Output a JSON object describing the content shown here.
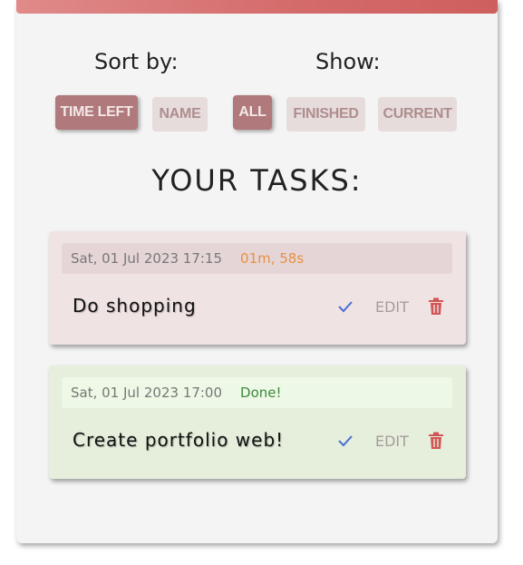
{
  "sort": {
    "label": "Sort by:",
    "options": [
      {
        "label": "TIME LEFT",
        "active": true
      },
      {
        "label": "NAME",
        "active": false
      }
    ]
  },
  "show": {
    "label": "Show:",
    "options": [
      {
        "label": "ALL",
        "active": true
      },
      {
        "label": "FINISHED",
        "active": false
      },
      {
        "label": "CURRENT",
        "active": false
      }
    ]
  },
  "tasks_title": "YOUR TASKS:",
  "tasks": [
    {
      "date": "Sat, 01 Jul 2023 17:15",
      "status": "01m, 58s",
      "name": "Do shopping",
      "edit_label": "EDIT",
      "done": false
    },
    {
      "date": "Sat, 01 Jul 2023 17:00",
      "status": "Done!",
      "name": "Create portfolio web!",
      "edit_label": "EDIT",
      "done": true
    }
  ],
  "colors": {
    "accent": "#d46a6a",
    "active_button": "#b0797c",
    "inactive_button": "#e6dcdc",
    "pending_card": "#f0e3e3",
    "done_card": "#e5efdc",
    "check_icon": "#4a6fd6",
    "delete_icon": "#d25555",
    "countdown_text": "#e69142",
    "done_text": "#3c8a3c"
  },
  "icons": {
    "check": "check-icon",
    "delete": "trash-icon"
  }
}
